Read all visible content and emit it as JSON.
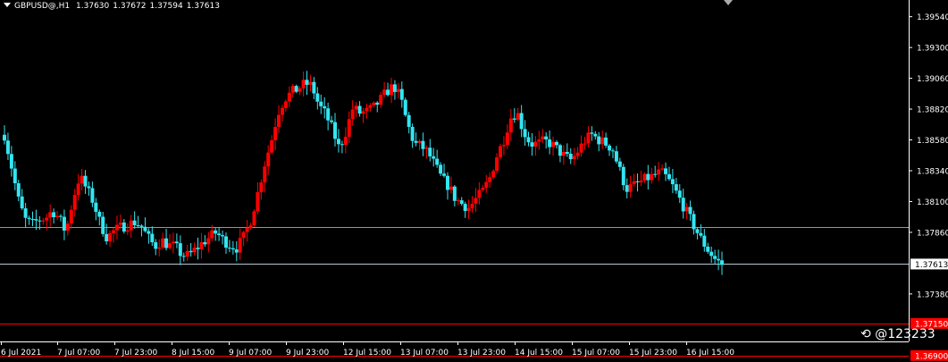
{
  "header": {
    "symbol": "GBPUSD@,H1",
    "open": "1.37630",
    "high": "1.37672",
    "low": "1.37594",
    "close": "1.37613"
  },
  "watermark": "@123233",
  "colors": {
    "background": "#000000",
    "bull": "#ff0000",
    "bear": "#33e6f2",
    "axis": "#ffffff",
    "level_green": "#00ff00",
    "level_red": "#ff0000",
    "current_price_line": "#b4c8d2"
  },
  "chart_data": {
    "type": "candlestick",
    "title": "GBPUSD@,H1",
    "ylim": [
      1.3701,
      1.3967
    ],
    "y_ticks": [
      "1.39540",
      "1.39300",
      "1.39060",
      "1.38820",
      "1.38580",
      "1.38340",
      "1.38100",
      "1.37860",
      "1.37613",
      "1.37380",
      "1.37150",
      "1.36900"
    ],
    "x_ticks": [
      "6 Jul 2021",
      "7 Jul 07:00",
      "7 Jul 23:00",
      "8 Jul 15:00",
      "9 Jul 07:00",
      "9 Jul 23:00",
      "12 Jul 15:00",
      "13 Jul 07:00",
      "13 Jul 23:00",
      "14 Jul 15:00",
      "15 Jul 07:00",
      "15 Jul 23:00",
      "16 Jul 15:00"
    ],
    "levels": [
      {
        "label": "1.37900",
        "value": 1.379,
        "color": "#00ff00"
      },
      {
        "label": "1.37613",
        "value": 1.37613,
        "color": "#ffffff"
      },
      {
        "label": "1.37150",
        "value": 1.3715,
        "color": "#ff0000"
      },
      {
        "label": "1.36900",
        "value": 1.369,
        "color": "#ff0000"
      }
    ],
    "close_path": [
      1.3862,
      1.3838,
      1.3812,
      1.3796,
      1.3792,
      1.3796,
      1.3797,
      1.3803,
      1.3797,
      1.3786,
      1.3811,
      1.383,
      1.382,
      1.381,
      1.3793,
      1.3782,
      1.3787,
      1.379,
      1.3792,
      1.3794,
      1.3791,
      1.3782,
      1.3775,
      1.378,
      1.3776,
      1.3775,
      1.3768,
      1.3768,
      1.3773,
      1.3778,
      1.3782,
      1.3786,
      1.378,
      1.3776,
      1.3774,
      1.3782,
      1.3795,
      1.3815,
      1.3838,
      1.3856,
      1.3879,
      1.389,
      1.3895,
      1.3898,
      1.3902,
      1.39,
      1.3885,
      1.3878,
      1.3866,
      1.3851,
      1.3865,
      1.3883,
      1.3879,
      1.388,
      1.3883,
      1.3889,
      1.3896,
      1.39,
      1.389,
      1.387,
      1.3855,
      1.3853,
      1.3848,
      1.3838,
      1.3828,
      1.3822,
      1.3812,
      1.3808,
      1.3805,
      1.3812,
      1.3818,
      1.3828,
      1.3845,
      1.3857,
      1.3875,
      1.388,
      1.3864,
      1.3855,
      1.3855,
      1.3857,
      1.3855,
      1.385,
      1.3845,
      1.3842,
      1.385,
      1.3858,
      1.3862,
      1.3858,
      1.3855,
      1.3851,
      1.3835,
      1.382,
      1.3822,
      1.3825,
      1.3828,
      1.383,
      1.3833,
      1.3828,
      1.382,
      1.381,
      1.38,
      1.379,
      1.378,
      1.3772,
      1.3765,
      1.3761
    ]
  }
}
